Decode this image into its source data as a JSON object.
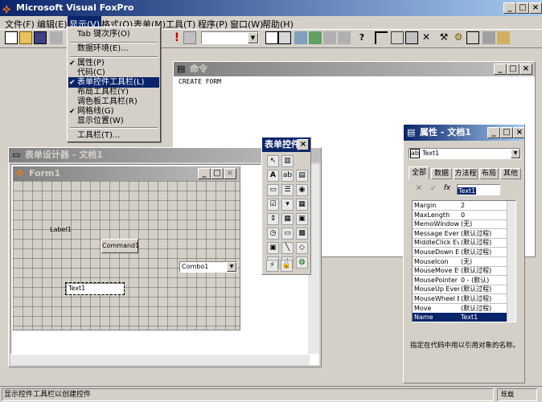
{
  "app": {
    "title": "Microsoft Visual FoxPro"
  },
  "menubar": [
    "文件(F)",
    "编辑(E)",
    "显示(V)",
    "格式(O)",
    "表单(M)",
    "工具(T)",
    "程序(P)",
    "窗口(W)",
    "帮助(H)"
  ],
  "view_menu": {
    "items": [
      "Tab 键次序(O)",
      "数据环境(E)...",
      "属性(P)",
      "代码(C)",
      "表单控件工具栏(L)",
      "布局工具栏(Y)",
      "调色板工具栏(R)",
      "网格线(G)",
      "显示位置(W)",
      "工具栏(T)..."
    ],
    "checked": [
      "属性(P)",
      "表单控件工具栏(L)",
      "网格线(G)"
    ],
    "selected": "表单控件工具栏(L)"
  },
  "command_window": {
    "title": "命令",
    "text": "CREATE FORM"
  },
  "form_designer": {
    "title": "表单设计器 - 文档1",
    "form_title": "Form1",
    "label": "Label1",
    "command": "Command1",
    "combo": "Combo1",
    "text": "Text1"
  },
  "controls_toolbar": {
    "title": "表单控件"
  },
  "properties": {
    "title": "属性 - 文档1",
    "object": "Text1",
    "tabs": [
      "全部",
      "数据",
      "方法程",
      "布局",
      "其他"
    ],
    "edit_value": "Text1",
    "rows": [
      [
        "Margin",
        "2"
      ],
      [
        "MaxLength",
        "0"
      ],
      [
        "MemoWindow",
        "(无)"
      ],
      [
        "Message Event",
        "(默认过程)"
      ],
      [
        "MiddleClick Event",
        "(默认过程)"
      ],
      [
        "MouseDown Event",
        "(默认过程)"
      ],
      [
        "MouseIcon",
        "(无)"
      ],
      [
        "MouseMove Event",
        "(默认过程)"
      ],
      [
        "MousePointer",
        "0 - (默认)"
      ],
      [
        "MouseUp Event",
        "(默认过程)"
      ],
      [
        "MouseWheel Event",
        "(默认过程)"
      ],
      [
        "Move",
        "(默认过程)"
      ],
      [
        "Name",
        "Text1"
      ]
    ],
    "selected_row": "Name",
    "description": "指定在代码中用以引用对象的名称。"
  },
  "statusbar": {
    "text": "显示控件工具栏以创建控件",
    "right": "既载"
  }
}
